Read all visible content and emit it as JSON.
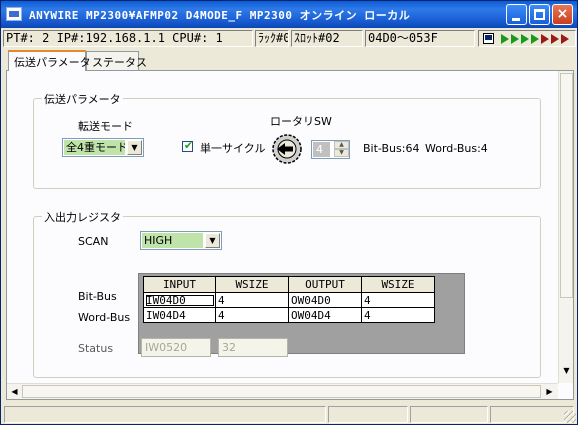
{
  "window": {
    "title": "ANYWIRE   MP2300¥AFMP02  D4MODE_F  MP2300    オンライン  ローカル",
    "buttons": {
      "minimize": "minimize",
      "maximize": "maximize",
      "close": "×"
    }
  },
  "infobar": {
    "connection": "PT#: 2 IP#:192.168.1.1 CPU#: 1",
    "rack": "ﾗｯｸ#01",
    "slot": "ｽﾛｯﾄ#02",
    "range": "04D0～053F",
    "led_colors": [
      "#1a9a1a",
      "#1a9a1a",
      "#1a9a1a",
      "#1a9a1a",
      "#9a1a1a",
      "#9a1a1a"
    ]
  },
  "tabs": [
    {
      "label": "伝送パラメータ",
      "active": true
    },
    {
      "label": "ステータス",
      "active": false
    }
  ],
  "transfer_params": {
    "title": "伝送パラメータ",
    "mode_label": "転送モード",
    "mode_value": "全4重モード",
    "single_cycle_label": "単一サイクル",
    "single_cycle_checked": true,
    "rotary_label": "ロータリSW",
    "rotary_value": "4",
    "bit_bus": "Bit-Bus:64",
    "word_bus": "Word-Bus:4"
  },
  "io_register": {
    "title": "入出力レジスタ",
    "scan_label": "SCAN",
    "scan_value": "HIGH",
    "columns": [
      "INPUT",
      "WSIZE",
      "OUTPUT",
      "WSIZE"
    ],
    "rows": [
      {
        "label": "Bit-Bus",
        "cells": [
          "IW04D0",
          "4",
          "OW04D0",
          "4"
        ]
      },
      {
        "label": "Word-Bus",
        "cells": [
          "IW04D4",
          "4",
          "OW04D4",
          "4"
        ]
      }
    ],
    "status_label": "Status",
    "status_register": "IW0520",
    "status_size": "32"
  },
  "scrollbars": {
    "left_arrow": "◀",
    "right_arrow": "▶",
    "up_arrow": "▲",
    "down_arrow": "▼"
  }
}
